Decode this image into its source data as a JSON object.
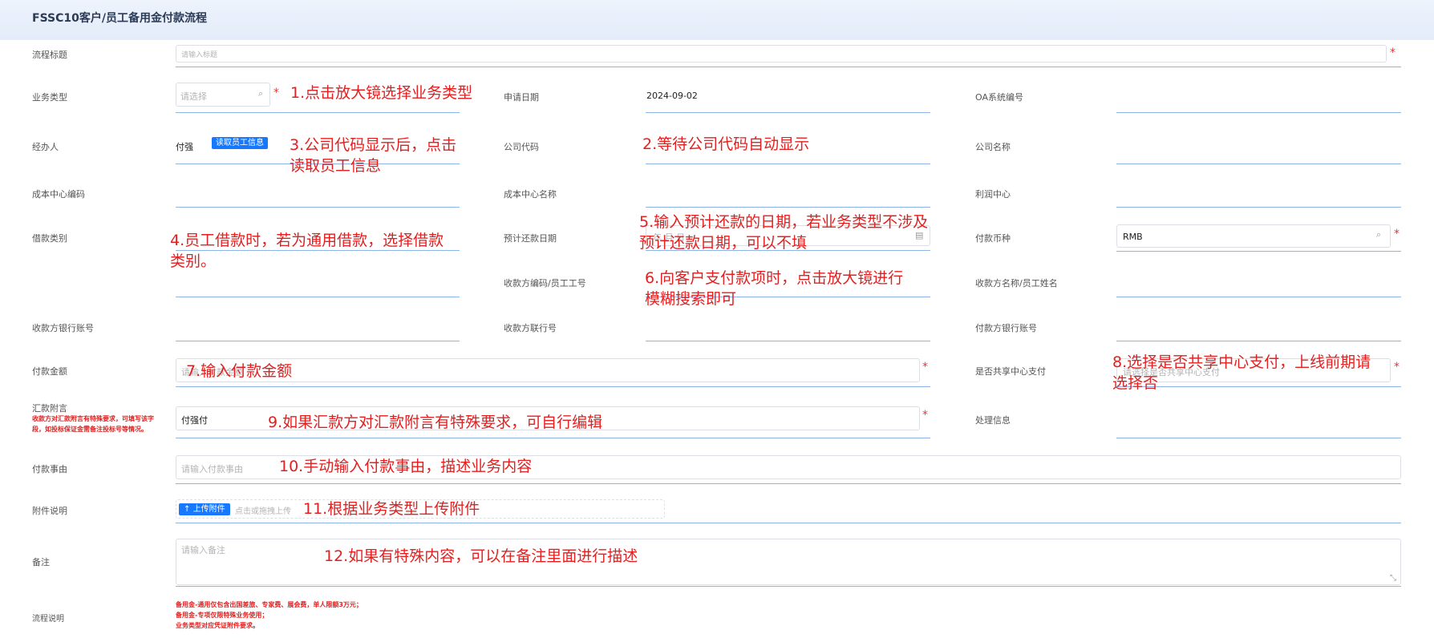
{
  "header": {
    "title": "FSSC10客户/员工备用金付款流程"
  },
  "labels": {
    "flow_title": "流程标题",
    "biz_type": "业务类型",
    "apply_date": "申请日期",
    "oa_no": "OA系统编号",
    "handler": "经办人",
    "company_code": "公司代码",
    "company_name": "公司名称",
    "cost_center_code": "成本中心编码",
    "cost_center_name": "成本中心名称",
    "profit_center": "利润中心",
    "loan_category": "借款类别",
    "expected_repay_date": "预计还款日期",
    "pay_currency": "付款币种",
    "payee_code": "收款方编码/员工工号",
    "payee_name": "收款方名称/员工姓名",
    "payee_bank_account": "收款方银行账号",
    "payee_bank_no": "收款方联行号",
    "payer_bank_account": "付款方银行账号",
    "pay_amount": "付款金额",
    "shared_center_pay": "是否共享中心支付",
    "remit_note": "汇款附言",
    "process_info": "处理信息",
    "pay_reason": "付款事由",
    "attachment_desc": "附件说明",
    "remark": "备注",
    "flow_desc": "流程说明"
  },
  "fields": {
    "flow_title_ph": "请输入标题",
    "biz_type_ph": "请选择",
    "apply_date": "2024-09-02",
    "handler": "付强",
    "read_employee_btn": "读取员工信息",
    "expected_repay_ph": "年 月 日",
    "currency": "RMB",
    "amount_ph": "请输入付款金额",
    "shared_pay_ph": "请选择是否共享中心支付",
    "remit_note": "付强付",
    "pay_reason_ph": "请输入付款事由",
    "upload_btn": "上传附件",
    "upload_hint": "点击或拖拽上传",
    "remark_ph": "请输入备注"
  },
  "remit_hint": [
    "收款方对汇款附言有特殊要求，可填写该字",
    "段，如投标保证金需备注投标号等情况。"
  ],
  "flow_desc_lines": [
    "备用金-通用仅包含出国差旅、专家费、展会费，单人限额3万元；",
    "备用金-专项仅限特殊业务使用；",
    "业务类型对应凭证附件要求。"
  ],
  "annotations": {
    "a1": "1.点击放大镜选择业务类型",
    "a2": "2.等待公司代码自动显示",
    "a3_1": "3.公司代码显示后，点击",
    "a3_2": "读取员工信息",
    "a4_1": "4.员工借款时，若为通用借款，选择借款",
    "a4_2": "类别。",
    "a5_1": "5.输入预计还款的日期，若业务类型不涉及",
    "a5_2": "预计还款日期，可以不填",
    "a6_1": "6.向客户支付款项时，点击放大镜进行",
    "a6_2": "模糊搜索即可",
    "a7": "7.输入付款金额",
    "a8_1": "8.选择是否共享中心支付，上线前期请",
    "a8_2": "选择否",
    "a9": "9.如果汇款方对汇款附言有特殊要求，可自行编辑",
    "a10": "10.手动输入付款事由，描述业务内容",
    "a11": "11.根据业务类型上传附件",
    "a12": "12.如果有特殊内容，可以在备注里面进行描述"
  },
  "icons": {
    "search": "search-icon",
    "calendar": "calendar-icon",
    "upload": "upload-icon",
    "resize": "resize-icon"
  },
  "colors": {
    "accent": "#1677ff",
    "annotation": "#e31f1f",
    "underline": "#8db4e6"
  }
}
